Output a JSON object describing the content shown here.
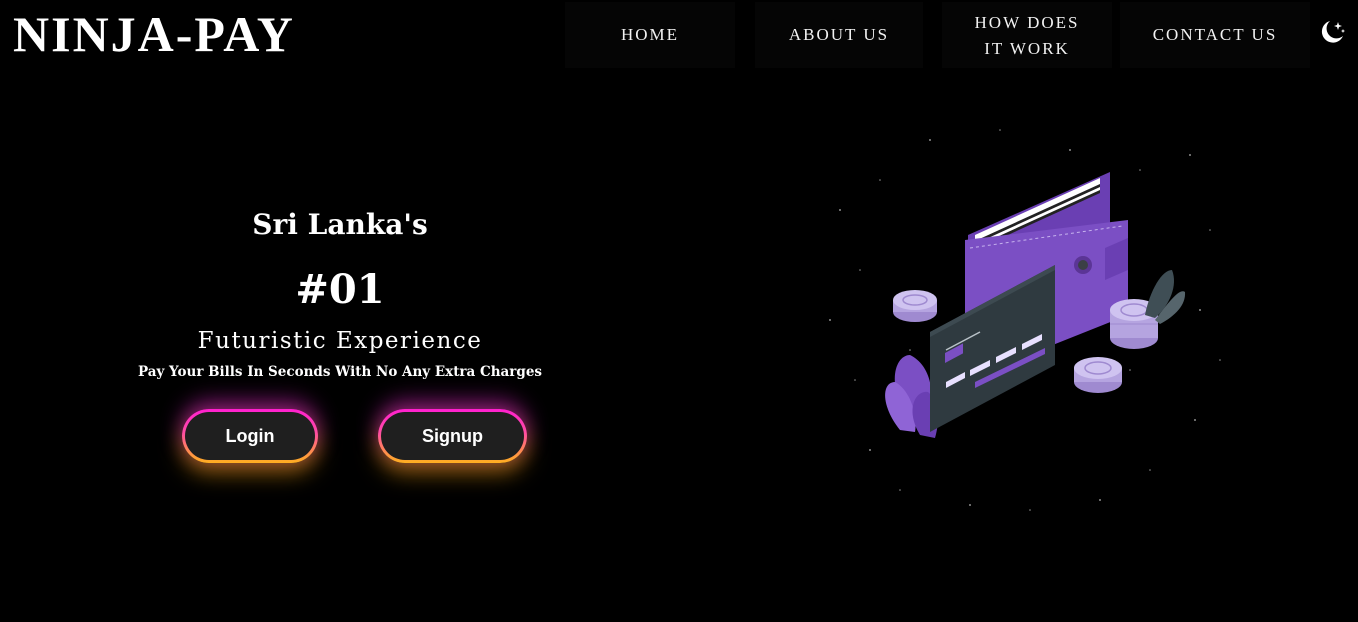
{
  "brand": {
    "name": "NINJA-PAY"
  },
  "nav": {
    "home": "HOME",
    "about": "ABOUT US",
    "how": "HOW DOES IT WORK",
    "contact": "CONTACT US"
  },
  "theme_toggle": {
    "icon": "moon-stars-icon"
  },
  "hero": {
    "title": "Sri Lanka's",
    "rank": "#01",
    "subtitle": "Futuristic Experience",
    "tagline": "Pay Your Bills In Seconds With No Any Extra Charges"
  },
  "buttons": {
    "login": "Login",
    "signup": "Signup"
  },
  "illustration": {
    "icon": "wallet-card-coins-illustration"
  },
  "colors": {
    "background": "#000000",
    "button_fill": "#1f1f1f",
    "glow_top": "#ff1fd0",
    "glow_bottom": "#ffb01f",
    "wallet": "#7b4fc4",
    "card": "#2f3a40"
  }
}
